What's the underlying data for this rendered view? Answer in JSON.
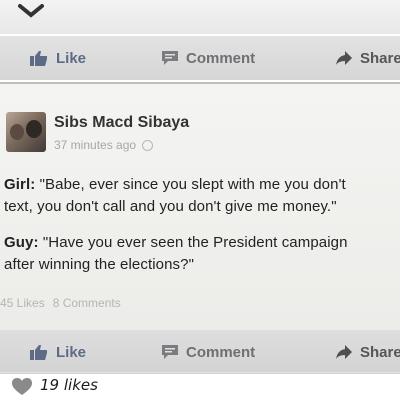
{
  "actions_top": {
    "like_label": "Like",
    "comment_label": "Comment",
    "share_label": "Share"
  },
  "post": {
    "author": "Sibs Macd Sibaya",
    "timestamp": "37 minutes ago",
    "lines": [
      {
        "speaker": "Girl:",
        "text": " \"Babe, ever since you slept with me you don't"
      },
      {
        "speaker": "",
        "text": "text, you don't call and you don't give me money.\""
      },
      {
        "speaker": "Guy:",
        "text": " \"Have you ever seen the President campaign"
      },
      {
        "speaker": "",
        "text": "after winning the elections?\""
      }
    ],
    "likes_count": "45 Likes",
    "comments_count": "8 Comments"
  },
  "actions_bottom": {
    "like_label": "Like",
    "comment_label": "Comment",
    "share_label": "Share"
  },
  "footer": {
    "likes_text": "19 likes"
  },
  "colors": {
    "like_blue": "#5e6b86",
    "action_gray": "#6d6f73",
    "meta_gray": "#a7a7a7"
  },
  "icons": [
    "chevron-down-icon",
    "thumbs-up-icon",
    "comment-icon",
    "share-arrow-icon",
    "globe-icon",
    "heart-icon"
  ]
}
